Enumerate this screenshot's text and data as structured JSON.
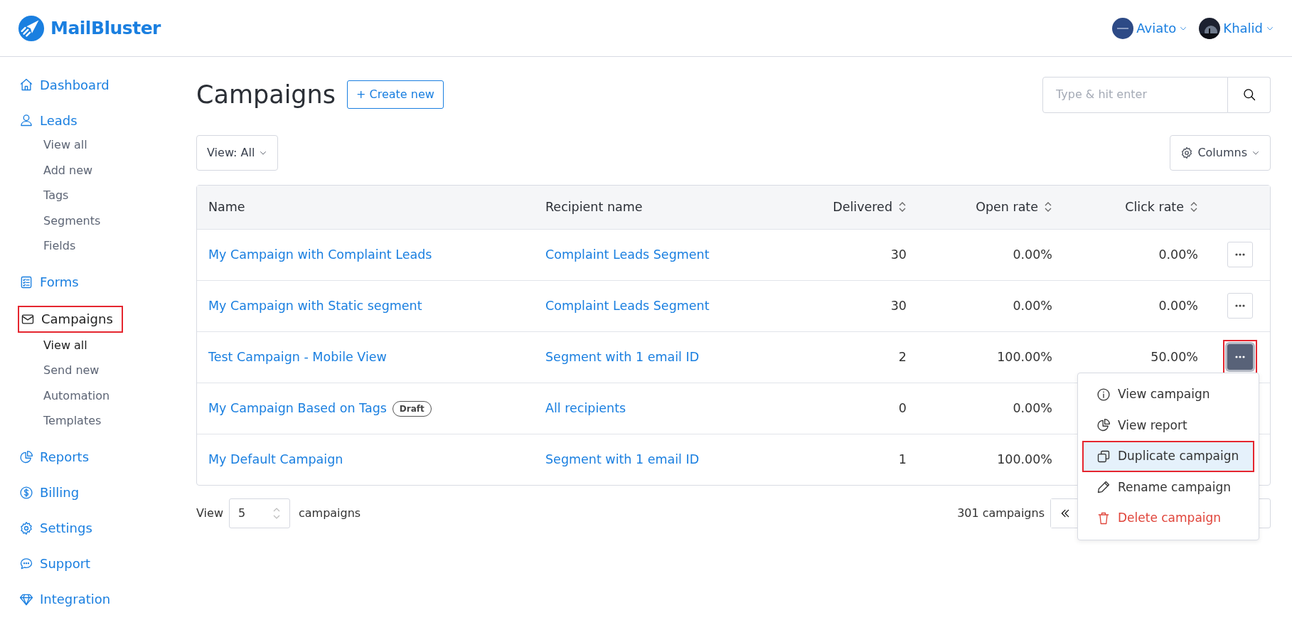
{
  "brand": {
    "name": "MailBluster"
  },
  "account_menus": [
    {
      "label": "Aviato",
      "kind": "workspace"
    },
    {
      "label": "Khalid",
      "kind": "user"
    }
  ],
  "sidebar": {
    "items": [
      {
        "label": "Dashboard",
        "selected": false,
        "highlighted": false
      },
      {
        "label": "Leads",
        "selected": false,
        "highlighted": false,
        "children": [
          {
            "label": "View all",
            "selected": false
          },
          {
            "label": "Add new",
            "selected": false
          },
          {
            "label": "Tags",
            "selected": false
          },
          {
            "label": "Segments",
            "selected": false
          },
          {
            "label": "Fields",
            "selected": false
          }
        ]
      },
      {
        "label": "Forms",
        "selected": false,
        "highlighted": false
      },
      {
        "label": "Campaigns",
        "selected": true,
        "highlighted": true,
        "children": [
          {
            "label": "View all",
            "selected": true
          },
          {
            "label": "Send new",
            "selected": false
          },
          {
            "label": "Automation",
            "selected": false
          },
          {
            "label": "Templates",
            "selected": false
          }
        ]
      },
      {
        "label": "Reports",
        "selected": false,
        "highlighted": false
      },
      {
        "label": "Billing",
        "selected": false,
        "highlighted": false
      },
      {
        "label": "Settings",
        "selected": false,
        "highlighted": false
      },
      {
        "label": "Support",
        "selected": false,
        "highlighted": false
      },
      {
        "label": "Integration",
        "selected": false,
        "highlighted": false
      }
    ]
  },
  "page": {
    "title": "Campaigns",
    "create_button": "+ Create new",
    "search": {
      "placeholder": "Type & hit enter"
    },
    "view_filter": "View: All",
    "columns_button": "Columns"
  },
  "table": {
    "columns": [
      {
        "label": "Name",
        "sortable": false
      },
      {
        "label": "Recipient name",
        "sortable": false
      },
      {
        "label": "Delivered",
        "sortable": true
      },
      {
        "label": "Open rate",
        "sortable": true
      },
      {
        "label": "Click rate",
        "sortable": true
      }
    ],
    "rows": [
      {
        "name": "My Campaign with Complaint Leads",
        "recipient": "Complaint Leads Segment",
        "delivered": "30",
        "open_rate": "0.00%",
        "click_rate": "0.00%",
        "menu_open": false,
        "highlighted": false
      },
      {
        "name": "My Campaign with Static segment",
        "recipient": "Complaint Leads Segment",
        "delivered": "30",
        "open_rate": "0.00%",
        "click_rate": "0.00%",
        "menu_open": false,
        "highlighted": false
      },
      {
        "name": "Test Campaign - Mobile View",
        "recipient": "Segment with 1 email ID",
        "delivered": "2",
        "open_rate": "100.00%",
        "click_rate": "50.00%",
        "menu_open": true,
        "highlighted": true
      },
      {
        "name": "My Campaign Based on Tags",
        "badge": "Draft",
        "recipient": "All recipients",
        "delivered": "0",
        "open_rate": "0.00%"
      },
      {
        "name": "My Default Campaign",
        "recipient": "Segment with 1 email ID",
        "delivered": "1",
        "open_rate": "100.00%"
      }
    ]
  },
  "footer": {
    "view_label": "View",
    "page_size": "5",
    "unit_label": "campaigns",
    "total": "301 campaigns"
  },
  "row_menu": {
    "items": [
      {
        "label": "View campaign",
        "kind": "normal",
        "active": false,
        "highlighted": false
      },
      {
        "label": "View report",
        "kind": "normal",
        "active": false,
        "highlighted": false
      },
      {
        "label": "Duplicate campaign",
        "kind": "normal",
        "active": true,
        "highlighted": true
      },
      {
        "label": "Rename campaign",
        "kind": "normal",
        "active": false,
        "highlighted": false
      },
      {
        "label": "Delete campaign",
        "kind": "danger",
        "active": false,
        "highlighted": false
      }
    ]
  }
}
